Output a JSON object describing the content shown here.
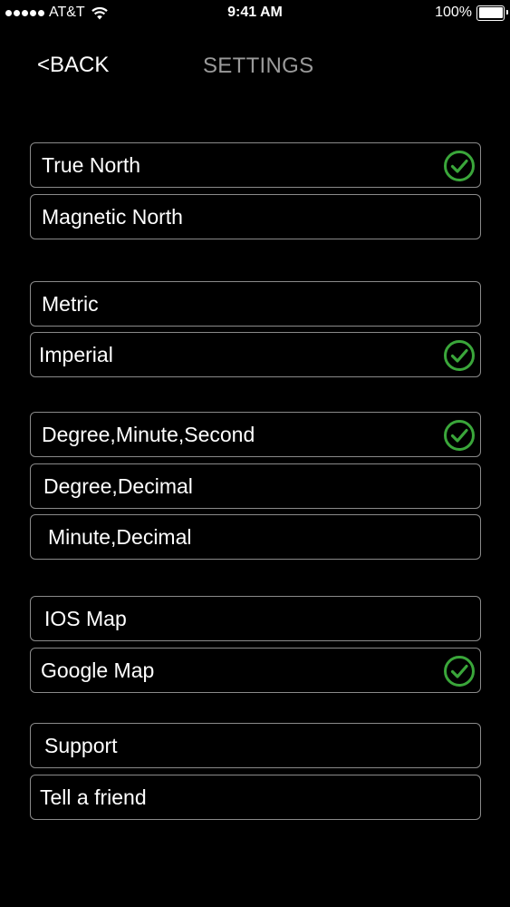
{
  "status_bar": {
    "carrier": "AT&T",
    "time": "9:41 AM",
    "battery": "100%",
    "battery_level": 1.0
  },
  "nav": {
    "back_label": "<BACK",
    "title": "SETTINGS"
  },
  "groups": {
    "north": {
      "true_north": {
        "label": "True North",
        "selected": true
      },
      "magnetic_north": {
        "label": "Magnetic North",
        "selected": false
      }
    },
    "units": {
      "metric": {
        "label": "Metric",
        "selected": false
      },
      "imperial": {
        "label": "Imperial",
        "selected": true
      }
    },
    "coordinates": {
      "dms": {
        "label": "Degree,Minute,Second",
        "selected": true
      },
      "degree_decimal": {
        "label": "Degree,Decimal",
        "selected": false
      },
      "minute_decimal": {
        "label": "Minute,Decimal",
        "selected": false
      }
    },
    "map": {
      "ios_map": {
        "label": "IOS Map",
        "selected": false
      },
      "google_map": {
        "label": "Google Map",
        "selected": true
      }
    },
    "other": {
      "support": {
        "label": "Support"
      },
      "tell_a_friend": {
        "label": "Tell a friend"
      }
    }
  },
  "colors": {
    "background": "#000000",
    "row_border": "#8a8a8a",
    "title_gray": "#9a9a9a",
    "check_green": "#3aa63a"
  }
}
